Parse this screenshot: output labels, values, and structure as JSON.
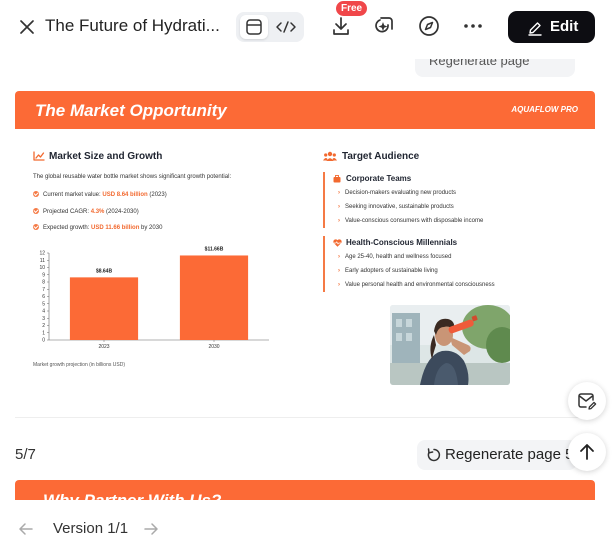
{
  "header": {
    "title": "The Future of Hydrati...",
    "free_badge": "Free",
    "edit_label": "Edit",
    "icons": [
      "close-icon",
      "preview-icon",
      "code-icon",
      "download-icon",
      "ai-sparkle-icon",
      "compass-icon",
      "more-icon",
      "pencil-icon"
    ]
  },
  "prev_hint": "Regenerate page",
  "slide": {
    "title": "The Market Opportunity",
    "brand": "AQUAFLOW PRO",
    "accent_color": "#fc6a36",
    "left": {
      "heading": "Market Size and Growth",
      "description": "The global reusable water bottle market shows significant growth potential:",
      "bullets": [
        {
          "prefix": "Current market value: ",
          "highlight": "USD 8.64 billion",
          "suffix": " (2023)"
        },
        {
          "prefix": "Projected CAGR: ",
          "highlight": "4.3%",
          "suffix": " (2024-2030)"
        },
        {
          "prefix": "Expected growth: ",
          "highlight": "USD 11.66 billion",
          "suffix": " by 2030"
        }
      ],
      "caption": "Market growth projection (in billions USD)"
    },
    "right": {
      "heading": "Target Audience",
      "groups": [
        {
          "title": "Corporate Teams",
          "items": [
            "Decision-makers evaluating new products",
            "Seeking innovative, sustainable products",
            "Value-conscious consumers with disposable income"
          ]
        },
        {
          "title": "Health-Conscious Millennials",
          "items": [
            "Age 25-40, health and wellness focused",
            "Early adopters of sustainable living",
            "Value personal health and environmental consciousness"
          ]
        }
      ]
    }
  },
  "chart_data": {
    "type": "bar",
    "categories": [
      "2023",
      "2030"
    ],
    "values": [
      8.64,
      11.66
    ],
    "data_labels": [
      "$8.64B",
      "$11.66B"
    ],
    "title": "",
    "xlabel": "",
    "ylabel": "",
    "ylim": [
      0,
      12
    ],
    "yticks": [
      0,
      1,
      2,
      3,
      4,
      5,
      6,
      7,
      8,
      9,
      10,
      11,
      12
    ],
    "color": "#fc6a36",
    "grid": false
  },
  "page_controls": {
    "page_indicator": "5/7",
    "regenerate_label": "Regenerate page 5"
  },
  "next_slide_title": "Why Partner With Us?",
  "footer": {
    "version_label": "Version 1/1"
  }
}
